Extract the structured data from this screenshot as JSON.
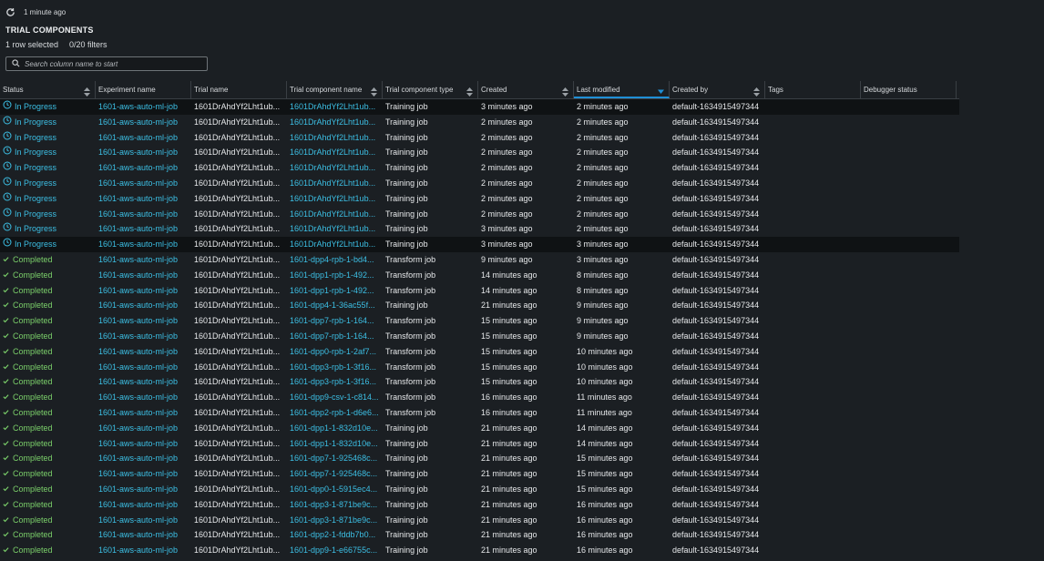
{
  "refresh": {
    "label": "1 minute ago"
  },
  "title": "TRIAL COMPONENTS",
  "selection": {
    "rows": "1 row selected",
    "filters": "0/20 filters"
  },
  "search": {
    "placeholder": "Search column name to start"
  },
  "columns": [
    {
      "label": "Status",
      "sortable": true
    },
    {
      "label": "Experiment name",
      "sortable": false
    },
    {
      "label": "Trial name",
      "sortable": false
    },
    {
      "label": "Trial component name",
      "sortable": true
    },
    {
      "label": "Trial component type",
      "sortable": true
    },
    {
      "label": "Created",
      "sortable": true
    },
    {
      "label": "Last modified",
      "sortable": true,
      "active": true
    },
    {
      "label": "Created by",
      "sortable": true
    },
    {
      "label": "Tags",
      "sortable": false
    },
    {
      "label": "Debugger status",
      "sortable": false
    }
  ],
  "colors": {
    "link": "#3cbfe4",
    "completed": "#7bd06a",
    "active_sort": "#1f8fd6"
  },
  "rows": [
    {
      "status": "In Progress",
      "experiment": "1601-aws-auto-ml-job",
      "trial": "1601DrAhdYf2Lht1ub...",
      "component": "1601DrAhdYf2Lht1ub...",
      "type": "Training job",
      "created": "3 minutes ago",
      "modified": "2 minutes ago",
      "created_by": "default-1634915497344",
      "dark": true
    },
    {
      "status": "In Progress",
      "experiment": "1601-aws-auto-ml-job",
      "trial": "1601DrAhdYf2Lht1ub...",
      "component": "1601DrAhdYf2Lht1ub...",
      "type": "Training job",
      "created": "2 minutes ago",
      "modified": "2 minutes ago",
      "created_by": "default-1634915497344"
    },
    {
      "status": "In Progress",
      "experiment": "1601-aws-auto-ml-job",
      "trial": "1601DrAhdYf2Lht1ub...",
      "component": "1601DrAhdYf2Lht1ub...",
      "type": "Training job",
      "created": "2 minutes ago",
      "modified": "2 minutes ago",
      "created_by": "default-1634915497344"
    },
    {
      "status": "In Progress",
      "experiment": "1601-aws-auto-ml-job",
      "trial": "1601DrAhdYf2Lht1ub...",
      "component": "1601DrAhdYf2Lht1ub...",
      "type": "Training job",
      "created": "2 minutes ago",
      "modified": "2 minutes ago",
      "created_by": "default-1634915497344"
    },
    {
      "status": "In Progress",
      "experiment": "1601-aws-auto-ml-job",
      "trial": "1601DrAhdYf2Lht1ub...",
      "component": "1601DrAhdYf2Lht1ub...",
      "type": "Training job",
      "created": "2 minutes ago",
      "modified": "2 minutes ago",
      "created_by": "default-1634915497344"
    },
    {
      "status": "In Progress",
      "experiment": "1601-aws-auto-ml-job",
      "trial": "1601DrAhdYf2Lht1ub...",
      "component": "1601DrAhdYf2Lht1ub...",
      "type": "Training job",
      "created": "2 minutes ago",
      "modified": "2 minutes ago",
      "created_by": "default-1634915497344"
    },
    {
      "status": "In Progress",
      "experiment": "1601-aws-auto-ml-job",
      "trial": "1601DrAhdYf2Lht1ub...",
      "component": "1601DrAhdYf2Lht1ub...",
      "type": "Training job",
      "created": "2 minutes ago",
      "modified": "2 minutes ago",
      "created_by": "default-1634915497344"
    },
    {
      "status": "In Progress",
      "experiment": "1601-aws-auto-ml-job",
      "trial": "1601DrAhdYf2Lht1ub...",
      "component": "1601DrAhdYf2Lht1ub...",
      "type": "Training job",
      "created": "2 minutes ago",
      "modified": "2 minutes ago",
      "created_by": "default-1634915497344"
    },
    {
      "status": "In Progress",
      "experiment": "1601-aws-auto-ml-job",
      "trial": "1601DrAhdYf2Lht1ub...",
      "component": "1601DrAhdYf2Lht1ub...",
      "type": "Training job",
      "created": "3 minutes ago",
      "modified": "2 minutes ago",
      "created_by": "default-1634915497344"
    },
    {
      "status": "In Progress",
      "experiment": "1601-aws-auto-ml-job",
      "trial": "1601DrAhdYf2Lht1ub...",
      "component": "1601DrAhdYf2Lht1ub...",
      "type": "Training job",
      "created": "3 minutes ago",
      "modified": "3 minutes ago",
      "created_by": "default-1634915497344",
      "dark": true
    },
    {
      "status": "Completed",
      "experiment": "1601-aws-auto-ml-job",
      "trial": "1601DrAhdYf2Lht1ub...",
      "component": "1601-dpp4-rpb-1-bd4...",
      "type": "Transform job",
      "created": "9 minutes ago",
      "modified": "3 minutes ago",
      "created_by": "default-1634915497344"
    },
    {
      "status": "Completed",
      "experiment": "1601-aws-auto-ml-job",
      "trial": "1601DrAhdYf2Lht1ub...",
      "component": "1601-dpp1-rpb-1-492...",
      "type": "Transform job",
      "created": "14 minutes ago",
      "modified": "8 minutes ago",
      "created_by": "default-1634915497344"
    },
    {
      "status": "Completed",
      "experiment": "1601-aws-auto-ml-job",
      "trial": "1601DrAhdYf2Lht1ub...",
      "component": "1601-dpp1-rpb-1-492...",
      "type": "Transform job",
      "created": "14 minutes ago",
      "modified": "8 minutes ago",
      "created_by": "default-1634915497344"
    },
    {
      "status": "Completed",
      "experiment": "1601-aws-auto-ml-job",
      "trial": "1601DrAhdYf2Lht1ub...",
      "component": "1601-dpp4-1-36ac55f...",
      "type": "Training job",
      "created": "21 minutes ago",
      "modified": "9 minutes ago",
      "created_by": "default-1634915497344"
    },
    {
      "status": "Completed",
      "experiment": "1601-aws-auto-ml-job",
      "trial": "1601DrAhdYf2Lht1ub...",
      "component": "1601-dpp7-rpb-1-164...",
      "type": "Transform job",
      "created": "15 minutes ago",
      "modified": "9 minutes ago",
      "created_by": "default-1634915497344"
    },
    {
      "status": "Completed",
      "experiment": "1601-aws-auto-ml-job",
      "trial": "1601DrAhdYf2Lht1ub...",
      "component": "1601-dpp7-rpb-1-164...",
      "type": "Transform job",
      "created": "15 minutes ago",
      "modified": "9 minutes ago",
      "created_by": "default-1634915497344"
    },
    {
      "status": "Completed",
      "experiment": "1601-aws-auto-ml-job",
      "trial": "1601DrAhdYf2Lht1ub...",
      "component": "1601-dpp0-rpb-1-2af7...",
      "type": "Transform job",
      "created": "15 minutes ago",
      "modified": "10 minutes ago",
      "created_by": "default-1634915497344"
    },
    {
      "status": "Completed",
      "experiment": "1601-aws-auto-ml-job",
      "trial": "1601DrAhdYf2Lht1ub...",
      "component": "1601-dpp3-rpb-1-3f16...",
      "type": "Transform job",
      "created": "15 minutes ago",
      "modified": "10 minutes ago",
      "created_by": "default-1634915497344"
    },
    {
      "status": "Completed",
      "experiment": "1601-aws-auto-ml-job",
      "trial": "1601DrAhdYf2Lht1ub...",
      "component": "1601-dpp3-rpb-1-3f16...",
      "type": "Transform job",
      "created": "15 minutes ago",
      "modified": "10 minutes ago",
      "created_by": "default-1634915497344"
    },
    {
      "status": "Completed",
      "experiment": "1601-aws-auto-ml-job",
      "trial": "1601DrAhdYf2Lht1ub...",
      "component": "1601-dpp9-csv-1-c814...",
      "type": "Transform job",
      "created": "16 minutes ago",
      "modified": "11 minutes ago",
      "created_by": "default-1634915497344"
    },
    {
      "status": "Completed",
      "experiment": "1601-aws-auto-ml-job",
      "trial": "1601DrAhdYf2Lht1ub...",
      "component": "1601-dpp2-rpb-1-d6e6...",
      "type": "Transform job",
      "created": "16 minutes ago",
      "modified": "11 minutes ago",
      "created_by": "default-1634915497344"
    },
    {
      "status": "Completed",
      "experiment": "1601-aws-auto-ml-job",
      "trial": "1601DrAhdYf2Lht1ub...",
      "component": "1601-dpp1-1-832d10e...",
      "type": "Training job",
      "created": "21 minutes ago",
      "modified": "14 minutes ago",
      "created_by": "default-1634915497344"
    },
    {
      "status": "Completed",
      "experiment": "1601-aws-auto-ml-job",
      "trial": "1601DrAhdYf2Lht1ub...",
      "component": "1601-dpp1-1-832d10e...",
      "type": "Training job",
      "created": "21 minutes ago",
      "modified": "14 minutes ago",
      "created_by": "default-1634915497344"
    },
    {
      "status": "Completed",
      "experiment": "1601-aws-auto-ml-job",
      "trial": "1601DrAhdYf2Lht1ub...",
      "component": "1601-dpp7-1-925468c...",
      "type": "Training job",
      "created": "21 minutes ago",
      "modified": "15 minutes ago",
      "created_by": "default-1634915497344"
    },
    {
      "status": "Completed",
      "experiment": "1601-aws-auto-ml-job",
      "trial": "1601DrAhdYf2Lht1ub...",
      "component": "1601-dpp7-1-925468c...",
      "type": "Training job",
      "created": "21 minutes ago",
      "modified": "15 minutes ago",
      "created_by": "default-1634915497344"
    },
    {
      "status": "Completed",
      "experiment": "1601-aws-auto-ml-job",
      "trial": "1601DrAhdYf2Lht1ub...",
      "component": "1601-dpp0-1-5915ec4...",
      "type": "Training job",
      "created": "21 minutes ago",
      "modified": "15 minutes ago",
      "created_by": "default-1634915497344"
    },
    {
      "status": "Completed",
      "experiment": "1601-aws-auto-ml-job",
      "trial": "1601DrAhdYf2Lht1ub...",
      "component": "1601-dpp3-1-871be9c...",
      "type": "Training job",
      "created": "21 minutes ago",
      "modified": "16 minutes ago",
      "created_by": "default-1634915497344"
    },
    {
      "status": "Completed",
      "experiment": "1601-aws-auto-ml-job",
      "trial": "1601DrAhdYf2Lht1ub...",
      "component": "1601-dpp3-1-871be9c...",
      "type": "Training job",
      "created": "21 minutes ago",
      "modified": "16 minutes ago",
      "created_by": "default-1634915497344"
    },
    {
      "status": "Completed",
      "experiment": "1601-aws-auto-ml-job",
      "trial": "1601DrAhdYf2Lht1ub...",
      "component": "1601-dpp2-1-fddb7b0...",
      "type": "Training job",
      "created": "21 minutes ago",
      "modified": "16 minutes ago",
      "created_by": "default-1634915497344"
    },
    {
      "status": "Completed",
      "experiment": "1601-aws-auto-ml-job",
      "trial": "1601DrAhdYf2Lht1ub...",
      "component": "1601-dpp9-1-e66755c...",
      "type": "Training job",
      "created": "21 minutes ago",
      "modified": "16 minutes ago",
      "created_by": "default-1634915497344"
    }
  ]
}
